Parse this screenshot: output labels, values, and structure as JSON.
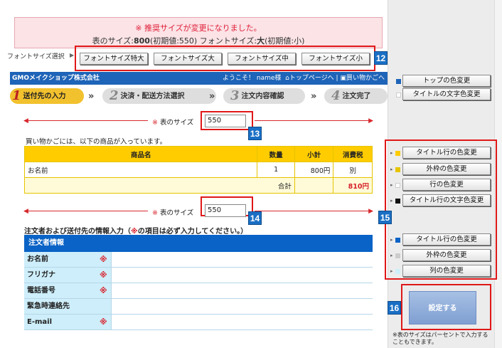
{
  "alert": {
    "line1": "※ 推奨サイズが変更になりました。",
    "line2_a": "表のサイズ:",
    "line2_b": "800",
    "line2_c": "(初期値:550)  フォントサイズ:",
    "line2_d": "大",
    "line2_e": "(初期値:小)"
  },
  "font_size": {
    "label": "フォントサイズ選択",
    "buttons": [
      "フォントサイズ特大",
      "フォントサイズ大",
      "フォントサイズ中",
      "フォントサイズ小"
    ]
  },
  "callouts": [
    "12",
    "13",
    "14",
    "15",
    "16"
  ],
  "header": {
    "shop": "GMOメイクショップ株式会社",
    "welcome": "ようこそ！ name様",
    "top_link": "トップページへ",
    "cart_link": "買い物かごへ"
  },
  "steps": [
    {
      "num": "1",
      "label": "送付先の入力"
    },
    {
      "num": "2",
      "label": "決済・配送方法選択"
    },
    {
      "num": "3",
      "label": "注文内容確認"
    },
    {
      "num": "4",
      "label": "注文完了"
    }
  ],
  "table_size": {
    "label": "表のサイズ",
    "asterisk": "※",
    "value1": "550",
    "value2": "550"
  },
  "cart": {
    "note": "買い物かごには、以下の商品が入っています。",
    "headers": [
      "商品名",
      "数量",
      "小計",
      "消費税"
    ],
    "row": {
      "name": "お名前",
      "qty": "1",
      "subtotal": "800円",
      "tax": "別"
    },
    "total_label": "合計",
    "total_value": "810円"
  },
  "orderer": {
    "title_a": "注文者および送付先の情報入力（",
    "title_ast": "※",
    "title_b": "の項目は必ず入力してください。）",
    "head": "注文者情報",
    "required_mark": "※",
    "rows": [
      {
        "label": "お名前",
        "required": true
      },
      {
        "label": "フリガナ",
        "required": true
      },
      {
        "label": "電話番号",
        "required": true
      },
      {
        "label": "緊急時連絡先",
        "required": false
      },
      {
        "label": "E-mail",
        "required": true
      }
    ]
  },
  "color_panel": {
    "top": [
      "トップの色変更",
      "タイトルの文字色変更"
    ],
    "group1": [
      "タイトル行の色変更",
      "外枠の色変更",
      "行の色変更",
      "タイトル行の文字色変更"
    ],
    "group2": [
      "タイトル行の色変更",
      "外枠の色変更",
      "列の色変更"
    ],
    "swatches": {
      "top1": "#1e64b8",
      "top2": "#ffffff",
      "g1a": "#ffcc00",
      "g1b": "#e6c400",
      "g1c": "#ffffff",
      "g1d": "#111111",
      "g2a": "#0a63c6",
      "g2b": "#cccccc",
      "g2c": "#cdeefa"
    }
  },
  "submit": {
    "label": "設定する"
  },
  "footnote": "※表のサイズはパーセントで入力することもできます。",
  "colors": {
    "accent_red": "#e01818",
    "callout_blue": "#1a6fc4"
  }
}
